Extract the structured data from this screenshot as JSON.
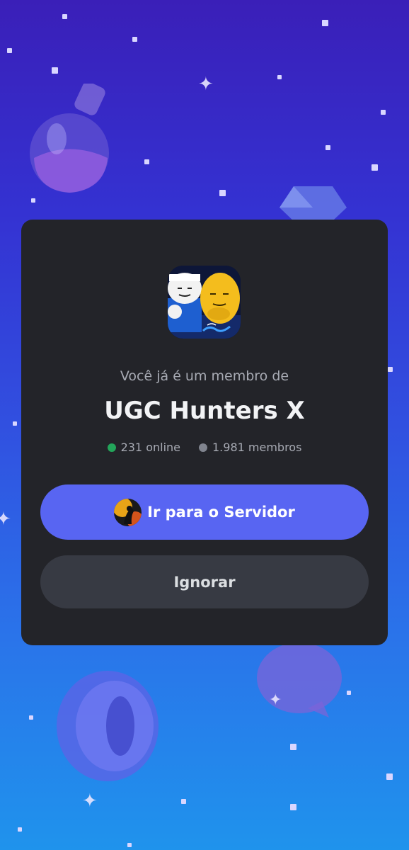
{
  "invite": {
    "subtitle": "Você já é um membro de",
    "server_name": "UGC Hunters X",
    "online_count": "231 online",
    "member_count": "1.981 membros",
    "primary_button": "Ir para o Servidor",
    "secondary_button": "Ignorar"
  },
  "colors": {
    "card_bg": "#232429",
    "primary": "#5865f2",
    "secondary": "#373a43",
    "online": "#23a55a",
    "members": "#80848e"
  },
  "icons": {
    "server": "server-icon-image",
    "avatar": "user-avatar",
    "online": "online-dot",
    "members": "members-dot"
  }
}
